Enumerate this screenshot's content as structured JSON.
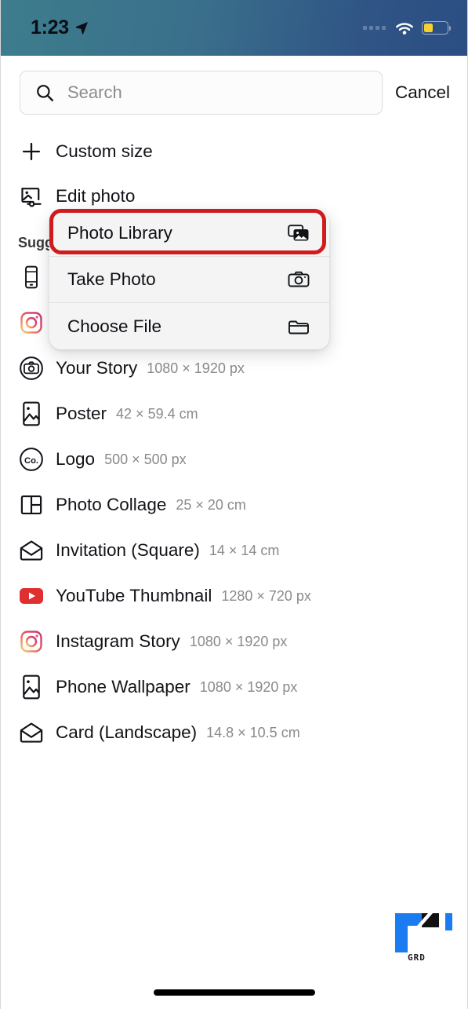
{
  "statusbar": {
    "time": "1:23",
    "location_icon": "location-arrow-icon",
    "wifi_icon": "wifi-icon",
    "battery_icon": "battery-low-power-icon",
    "battery_fill_percent": 40,
    "battery_color": "#f5d02e",
    "bg_left_color": "#3d7d8d",
    "bg_right_color": "#2c4e83"
  },
  "search": {
    "placeholder": "Search",
    "value": "",
    "icon": "search-icon",
    "cancel_label": "Cancel"
  },
  "list": {
    "custom_size": {
      "label": "Custom size",
      "icon": "plus-icon"
    },
    "edit_photo": {
      "label": "Edit photo",
      "icon": "edit-photo-icon"
    },
    "section_label": "Sugg",
    "items": [
      {
        "label": "Your Story",
        "dimension": "1080 × 1920 px",
        "icon": "camera-circle-icon"
      },
      {
        "label": "Poster",
        "dimension": "42 × 59.4 cm",
        "icon": "portrait-image-icon"
      },
      {
        "label": "Logo",
        "dimension": "500 × 500 px",
        "icon": "logo-circle-icon"
      },
      {
        "label": "Photo Collage",
        "dimension": "25 × 20 cm",
        "icon": "collage-grid-icon"
      },
      {
        "label": "Invitation (Square)",
        "dimension": "14 × 14 cm",
        "icon": "envelope-icon"
      },
      {
        "label": "YouTube Thumbnail",
        "dimension": "1280 × 720 px",
        "icon": "youtube-icon"
      },
      {
        "label": "Instagram Story",
        "dimension": "1080 × 1920 px",
        "icon": "instagram-icon"
      },
      {
        "label": "Phone Wallpaper",
        "dimension": "1080 × 1920 px",
        "icon": "portrait-image-icon"
      },
      {
        "label": "Card (Landscape)",
        "dimension": "14.8 × 10.5 cm",
        "icon": "envelope-icon"
      }
    ],
    "hidden_icons": [
      {
        "icon": "phone-device-icon"
      },
      {
        "icon": "instagram-icon"
      }
    ]
  },
  "dropdown": {
    "items": [
      {
        "label": "Photo Library",
        "icon": "photo-stack-icon",
        "highlighted": true
      },
      {
        "label": "Take Photo",
        "icon": "camera-icon",
        "highlighted": false
      },
      {
        "label": "Choose File",
        "icon": "folder-icon",
        "highlighted": false
      }
    ],
    "highlight_color": "#cf1b1b"
  },
  "watermark": {
    "text": "GRD",
    "blue": "#1a7cf0"
  }
}
